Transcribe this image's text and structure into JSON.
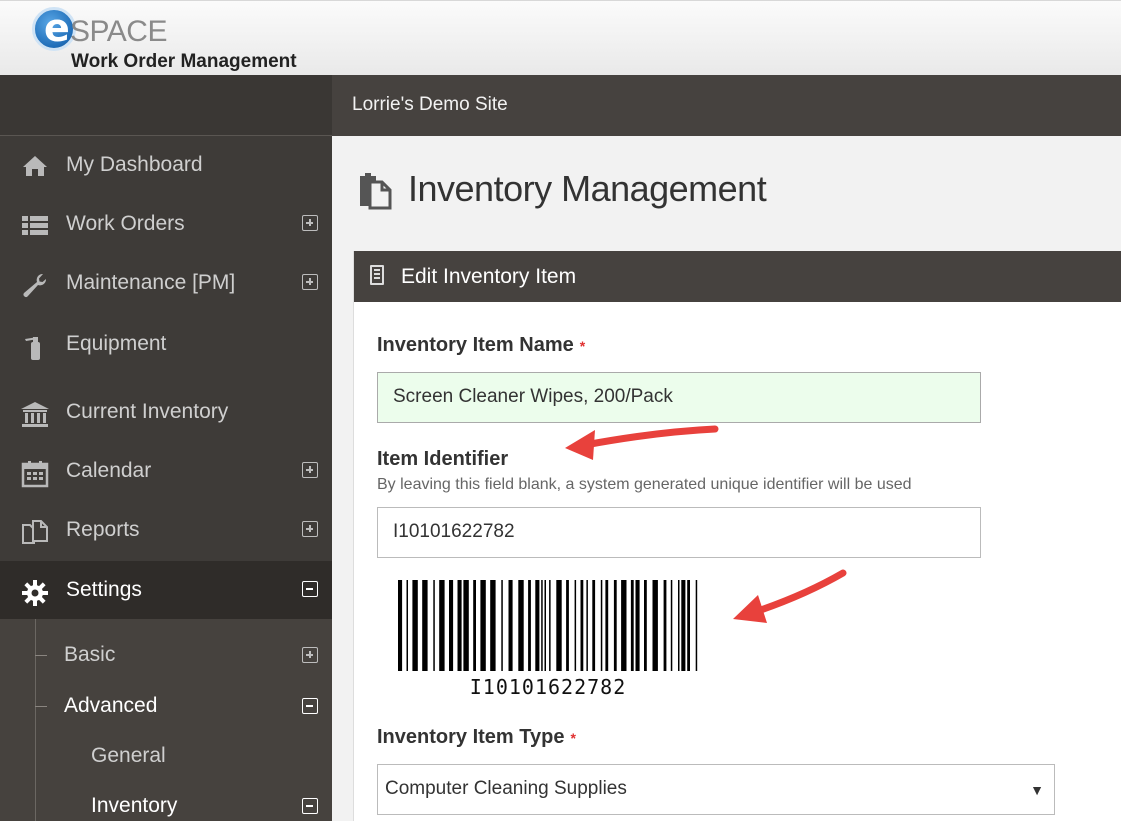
{
  "header": {
    "logo_letter": "e",
    "logo_text": "SPACE",
    "app_title": "Work Order Management"
  },
  "site": {
    "name": "Lorrie's Demo Site"
  },
  "sidebar": {
    "items": [
      {
        "label": "My Dashboard",
        "icon": "home-icon",
        "expander": "none"
      },
      {
        "label": "Work Orders",
        "icon": "list-icon",
        "expander": "plus"
      },
      {
        "label": "Maintenance [PM]",
        "icon": "wrench-icon",
        "expander": "plus"
      },
      {
        "label": "Equipment",
        "icon": "fire-extinguisher-icon",
        "expander": "none"
      },
      {
        "label": "Current Inventory",
        "icon": "bank-icon",
        "expander": "none"
      },
      {
        "label": "Calendar",
        "icon": "calendar-icon",
        "expander": "plus"
      },
      {
        "label": "Reports",
        "icon": "copy-icon",
        "expander": "plus"
      },
      {
        "label": "Settings",
        "icon": "gear-icon",
        "expander": "minus",
        "active": true
      }
    ],
    "sub_items": [
      {
        "label": "Basic",
        "expander": "plus"
      },
      {
        "label": "Advanced",
        "expander": "minus",
        "selected": true
      },
      {
        "label": "General",
        "expander": "none"
      },
      {
        "label": "Inventory",
        "expander": "minus",
        "selected": true
      }
    ]
  },
  "page": {
    "title": "Inventory Management",
    "panel_title": "Edit Inventory Item"
  },
  "form": {
    "item_name_label": "Inventory Item Name",
    "required_mark": "*",
    "item_name_value": "Screen Cleaner Wipes, 200/Pack",
    "identifier_label": "Item Identifier",
    "identifier_help": "By leaving this field blank, a system generated unique identifier will be used",
    "identifier_value": "I10101622782",
    "barcode_text": "I10101622782",
    "item_type_label": "Inventory Item Type",
    "item_type_value": "Computer Cleaning Supplies",
    "item_type_caret": "▼"
  },
  "colors": {
    "sidebar_bg": "#3e3b38",
    "header_bar": "#46423f",
    "valid_input_bg": "#ecfdec",
    "annotation_arrow": "#e8413c"
  }
}
